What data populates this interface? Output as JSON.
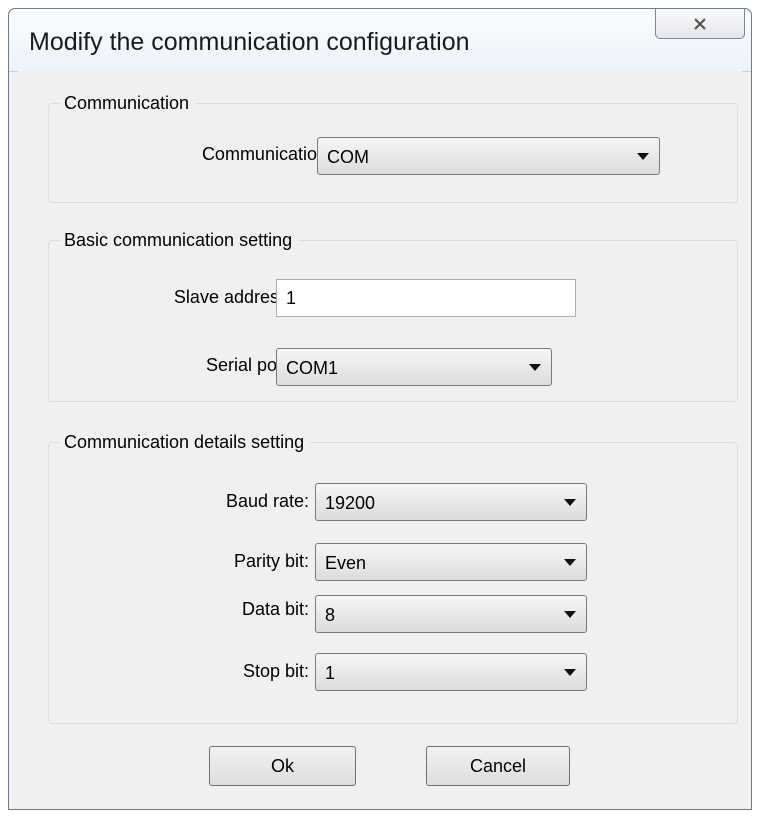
{
  "window": {
    "title": "Modify the communication configuration",
    "close_icon": "close-x-icon"
  },
  "communication_group": {
    "legend": "Communication",
    "communication_label": "Communication:",
    "communication_value": "COM"
  },
  "basic_group": {
    "legend": "Basic communication setting",
    "slave_address_label": "Slave address:",
    "slave_address_value": "1",
    "serial_port_label": "Serial port:",
    "serial_port_value": "COM1"
  },
  "details_group": {
    "legend": "Communication details setting",
    "baud_rate_label": "Baud rate:",
    "baud_rate_value": "19200",
    "parity_bit_label": "Parity bit:",
    "parity_bit_value": "Even",
    "data_bit_label": "Data bit:",
    "data_bit_value": "8",
    "stop_bit_label": "Stop bit:",
    "stop_bit_value": "1"
  },
  "buttons": {
    "ok_label": "Ok",
    "cancel_label": "Cancel"
  }
}
